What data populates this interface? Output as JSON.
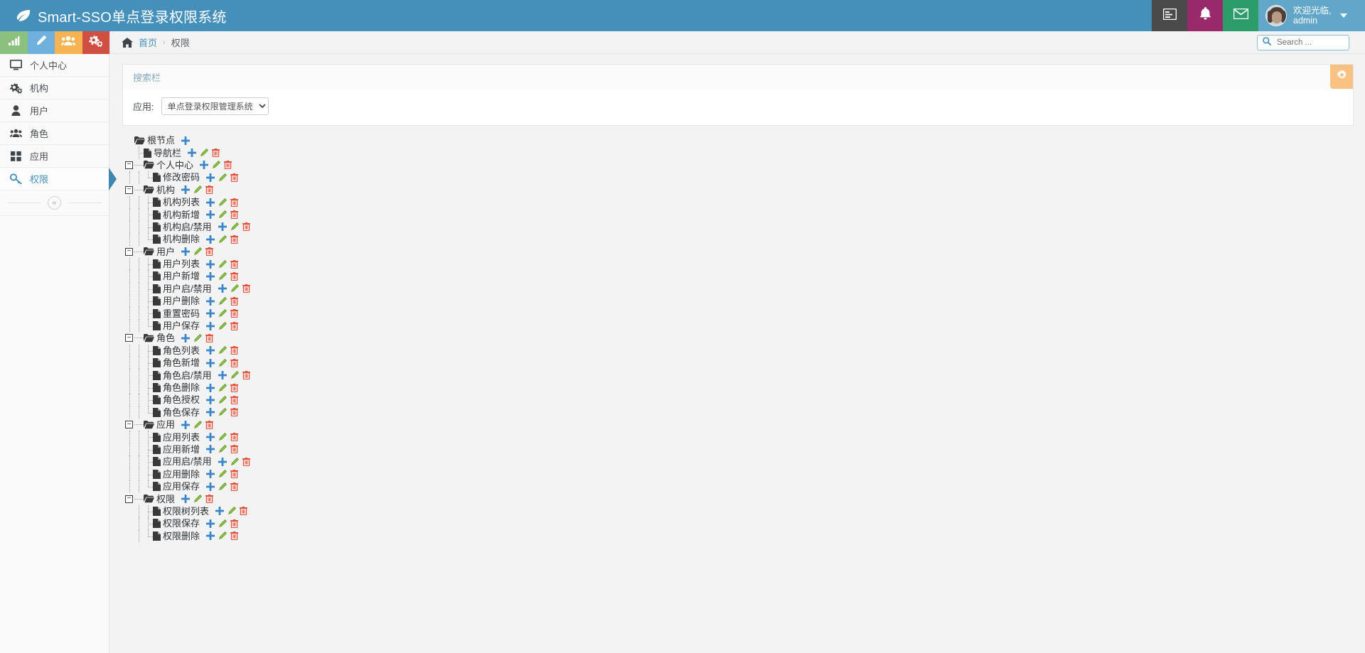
{
  "navbar": {
    "brand": "Smart-SSO单点登录权限系统",
    "brand_icon": "leaf-icon",
    "buttons": [
      {
        "name": "tasks-icon",
        "color": "#4a4a4a"
      },
      {
        "name": "bell-icon",
        "color": "#98296b"
      },
      {
        "name": "mail-icon",
        "color": "#2c9c6a"
      }
    ],
    "user": {
      "greeting": "欢迎光临,",
      "username": "admin",
      "avatar": "user-avatar"
    }
  },
  "quicktiles": [
    {
      "name": "chart-tile",
      "icon": "bar-chart-icon",
      "color": "#8cc07f"
    },
    {
      "name": "edit-tile",
      "icon": "pencil-icon",
      "color": "#6fb0dc"
    },
    {
      "name": "users-tile",
      "icon": "users-icon",
      "color": "#f6b352"
    },
    {
      "name": "settings-tile",
      "icon": "gears-icon",
      "color": "#cf4f43"
    }
  ],
  "breadcrumb": {
    "home_icon": "home-icon",
    "home": "首页",
    "separator": "›",
    "current": "权限"
  },
  "search": {
    "placeholder": "Search ...",
    "value": "",
    "icon": "search-icon"
  },
  "sidebar": {
    "items": [
      {
        "label": "个人中心",
        "icon": "desktop-icon",
        "active": false
      },
      {
        "label": "机构",
        "icon": "gears-icon",
        "active": false
      },
      {
        "label": "用户",
        "icon": "user-icon",
        "active": false
      },
      {
        "label": "角色",
        "icon": "users-icon",
        "active": false
      },
      {
        "label": "应用",
        "icon": "grid-icon",
        "active": false
      },
      {
        "label": "权限",
        "icon": "key-icon",
        "active": true
      }
    ],
    "collapse_label": "«"
  },
  "panel": {
    "title": "搜索栏",
    "gear_icon": "gear-icon",
    "form": {
      "label": "应用:",
      "select_value": "单点登录权限管理系统",
      "options": [
        "单点登录权限管理系统"
      ]
    }
  },
  "tree": {
    "actions": {
      "add": "+",
      "edit": "pencil-icon",
      "delete": "trash-icon"
    },
    "root": {
      "label": "根节点",
      "icon": "folder-open-icon",
      "actions": [
        "add"
      ]
    },
    "nodes": [
      {
        "label": "导航栏",
        "icon": "file-icon",
        "level": 1,
        "type": "leaf",
        "actions": [
          "add",
          "edit",
          "delete"
        ]
      },
      {
        "label": "个人中心",
        "icon": "folder-open-icon",
        "level": 1,
        "type": "branch",
        "toggle": "−",
        "actions": [
          "add",
          "edit",
          "delete"
        ],
        "children": [
          {
            "label": "修改密码",
            "icon": "file-icon",
            "actions": [
              "add",
              "edit",
              "delete"
            ]
          }
        ]
      },
      {
        "label": "机构",
        "icon": "folder-open-icon",
        "level": 1,
        "type": "branch",
        "toggle": "−",
        "actions": [
          "add",
          "edit",
          "delete"
        ],
        "children": [
          {
            "label": "机构列表",
            "icon": "file-icon",
            "actions": [
              "add",
              "edit",
              "delete"
            ]
          },
          {
            "label": "机构新增",
            "icon": "file-icon",
            "actions": [
              "add",
              "edit",
              "delete"
            ]
          },
          {
            "label": "机构启/禁用",
            "icon": "file-icon",
            "actions": [
              "add",
              "edit",
              "delete"
            ]
          },
          {
            "label": "机构删除",
            "icon": "file-icon",
            "actions": [
              "add",
              "edit",
              "delete"
            ]
          }
        ]
      },
      {
        "label": "用户",
        "icon": "folder-open-icon",
        "level": 1,
        "type": "branch",
        "toggle": "−",
        "actions": [
          "add",
          "edit",
          "delete"
        ],
        "children": [
          {
            "label": "用户列表",
            "icon": "file-icon",
            "actions": [
              "add",
              "edit",
              "delete"
            ]
          },
          {
            "label": "用户新增",
            "icon": "file-icon",
            "actions": [
              "add",
              "edit",
              "delete"
            ]
          },
          {
            "label": "用户启/禁用",
            "icon": "file-icon",
            "actions": [
              "add",
              "edit",
              "delete"
            ]
          },
          {
            "label": "用户删除",
            "icon": "file-icon",
            "actions": [
              "add",
              "edit",
              "delete"
            ]
          },
          {
            "label": "重置密码",
            "icon": "file-icon",
            "actions": [
              "add",
              "edit",
              "delete"
            ]
          },
          {
            "label": "用户保存",
            "icon": "file-icon",
            "actions": [
              "add",
              "edit",
              "delete"
            ]
          }
        ]
      },
      {
        "label": "角色",
        "icon": "folder-open-icon",
        "level": 1,
        "type": "branch",
        "toggle": "−",
        "actions": [
          "add",
          "edit",
          "delete"
        ],
        "children": [
          {
            "label": "角色列表",
            "icon": "file-icon",
            "actions": [
              "add",
              "edit",
              "delete"
            ]
          },
          {
            "label": "角色新增",
            "icon": "file-icon",
            "actions": [
              "add",
              "edit",
              "delete"
            ]
          },
          {
            "label": "角色启/禁用",
            "icon": "file-icon",
            "actions": [
              "add",
              "edit",
              "delete"
            ]
          },
          {
            "label": "角色删除",
            "icon": "file-icon",
            "actions": [
              "add",
              "edit",
              "delete"
            ]
          },
          {
            "label": "角色授权",
            "icon": "file-icon",
            "actions": [
              "add",
              "edit",
              "delete"
            ]
          },
          {
            "label": "角色保存",
            "icon": "file-icon",
            "actions": [
              "add",
              "edit",
              "delete"
            ]
          }
        ]
      },
      {
        "label": "应用",
        "icon": "folder-open-icon",
        "level": 1,
        "type": "branch",
        "toggle": "−",
        "actions": [
          "add",
          "edit",
          "delete"
        ],
        "children": [
          {
            "label": "应用列表",
            "icon": "file-icon",
            "actions": [
              "add",
              "edit",
              "delete"
            ]
          },
          {
            "label": "应用新增",
            "icon": "file-icon",
            "actions": [
              "add",
              "edit",
              "delete"
            ]
          },
          {
            "label": "应用启/禁用",
            "icon": "file-icon",
            "actions": [
              "add",
              "edit",
              "delete"
            ]
          },
          {
            "label": "应用删除",
            "icon": "file-icon",
            "actions": [
              "add",
              "edit",
              "delete"
            ]
          },
          {
            "label": "应用保存",
            "icon": "file-icon",
            "actions": [
              "add",
              "edit",
              "delete"
            ]
          }
        ]
      },
      {
        "label": "权限",
        "icon": "folder-open-icon",
        "level": 1,
        "type": "branch",
        "toggle": "−",
        "actions": [
          "add",
          "edit",
          "delete"
        ],
        "children": [
          {
            "label": "权限树列表",
            "icon": "file-icon",
            "actions": [
              "add",
              "edit",
              "delete"
            ]
          },
          {
            "label": "权限保存",
            "icon": "file-icon",
            "actions": [
              "add",
              "edit",
              "delete"
            ]
          },
          {
            "label": "权限删除",
            "icon": "file-icon",
            "actions": [
              "add",
              "edit",
              "delete"
            ]
          }
        ]
      }
    ]
  },
  "colors": {
    "navbar": "#4590bb",
    "accent": "#4590bb",
    "panel_gear": "#fac282",
    "add": "#3a86c8",
    "edit": "#7ab648",
    "delete": "#e4513a"
  }
}
